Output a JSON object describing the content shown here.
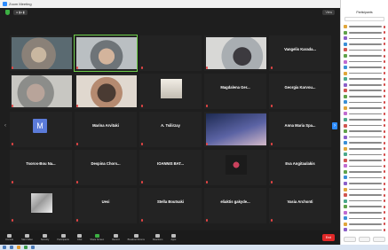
{
  "window": {
    "title": "Zoom Meeting"
  },
  "top": {
    "status_left": "● ▮◂ ▮",
    "view_button": "View"
  },
  "grid": {
    "tiles": [
      {
        "name": "",
        "label": "",
        "photo": "v1",
        "pos": "left",
        "active": false
      },
      {
        "name": "",
        "label": "",
        "photo": "v2",
        "pos": "left",
        "active": true
      },
      {
        "name": "",
        "label": "",
        "photo": "",
        "pos": "",
        "active": false
      },
      {
        "name": "",
        "label": "",
        "photo": "v3",
        "pos": "left",
        "active": false
      },
      {
        "name": "Vangelis Karada...",
        "label": "",
        "photo": "",
        "pos": "",
        "active": false
      },
      {
        "name": "",
        "label": "",
        "photo": "v4",
        "pos": "left",
        "active": false
      },
      {
        "name": "",
        "label": "",
        "photo": "v5",
        "pos": "left",
        "active": false
      },
      {
        "name": "",
        "label": "",
        "photo": "v6",
        "pos": "center",
        "active": false
      },
      {
        "name": "Magdalena Ger...",
        "label": "",
        "photo": "",
        "pos": "",
        "active": false
      },
      {
        "name": "Georgia Karvou...",
        "label": "",
        "photo": "",
        "pos": "",
        "active": false
      },
      {
        "name": "",
        "label": "",
        "photo": "",
        "pos": "",
        "active": false,
        "avatar": "M"
      },
      {
        "name": "Marina Arvitaki",
        "label": "",
        "photo": "",
        "pos": "",
        "active": false
      },
      {
        "name": "A. Tsilirzay",
        "label": "",
        "photo": "",
        "pos": "",
        "active": false
      },
      {
        "name": "",
        "label": "",
        "photo": "v7",
        "pos": "left",
        "active": false
      },
      {
        "name": "Anna Maria Spa...",
        "label": "",
        "photo": "",
        "pos": "",
        "active": false
      },
      {
        "name": "Tsoros-Bou Na...",
        "label": "",
        "photo": "",
        "pos": "",
        "active": false
      },
      {
        "name": "Despina Chors...",
        "label": "",
        "photo": "",
        "pos": "",
        "active": false
      },
      {
        "name": "IOANNIS BAT...",
        "label": "",
        "photo": "",
        "pos": "",
        "active": false
      },
      {
        "name": "",
        "label": "",
        "photo": "v8",
        "pos": "center",
        "active": false
      },
      {
        "name": "Eva Angitaulakis",
        "label": "",
        "photo": "",
        "pos": "",
        "active": false
      },
      {
        "name": "",
        "label": "",
        "photo": "v9",
        "pos": "center",
        "active": false
      },
      {
        "name": "Uesi",
        "label": "",
        "photo": "",
        "pos": "",
        "active": false
      },
      {
        "name": "Stella Boutsaki",
        "label": "",
        "photo": "",
        "pos": "",
        "active": false
      },
      {
        "name": "eliaktis gakyde...",
        "label": "",
        "photo": "",
        "pos": "",
        "active": false
      },
      {
        "name": "Vasia Archonti",
        "label": "",
        "photo": "",
        "pos": "",
        "active": false
      }
    ]
  },
  "toolbar": {
    "buttons": [
      {
        "label": "Unmute",
        "icon": "mic-icon"
      },
      {
        "label": "Start Video",
        "icon": "camera-icon"
      },
      {
        "label": "Security",
        "icon": "shield-icon"
      },
      {
        "label": "Participants",
        "icon": "people-icon"
      },
      {
        "label": "Chat",
        "icon": "chat-icon"
      },
      {
        "label": "Share Screen",
        "icon": "share-icon"
      },
      {
        "label": "Record",
        "icon": "record-icon"
      },
      {
        "label": "Breakout Rooms",
        "icon": "breakout-icon"
      },
      {
        "label": "Reactions",
        "icon": "reactions-icon"
      },
      {
        "label": "Apps",
        "icon": "apps-icon"
      }
    ],
    "end_label": "End"
  },
  "participants_panel": {
    "title": "Participants",
    "search_placeholder": "",
    "avatar_colors": [
      "#e0a63a",
      "#5fa24a",
      "#8b5fc8",
      "#3a8fd6",
      "#d0554f",
      "#5fa24a",
      "#c06bd0",
      "#3a8fd6",
      "#e0a63a",
      "#4aa88b",
      "#8b5fc8",
      "#d0554f",
      "#5fa24a",
      "#3a8fd6",
      "#e0a63a",
      "#c06bd0",
      "#4aa88b",
      "#d0554f",
      "#5fa24a",
      "#8b5fc8",
      "#3a8fd6",
      "#e0a63a",
      "#4aa88b",
      "#d0554f",
      "#c06bd0",
      "#5fa24a",
      "#3a8fd6",
      "#8b5fc8",
      "#e0a63a",
      "#d0554f",
      "#4aa88b",
      "#5fa24a",
      "#c06bd0",
      "#3a8fd6",
      "#e0a63a",
      "#8b5fc8"
    ]
  },
  "colors": {
    "accent": "#2d8cff",
    "end": "#e02828",
    "active_border": "#6fcf4a"
  }
}
